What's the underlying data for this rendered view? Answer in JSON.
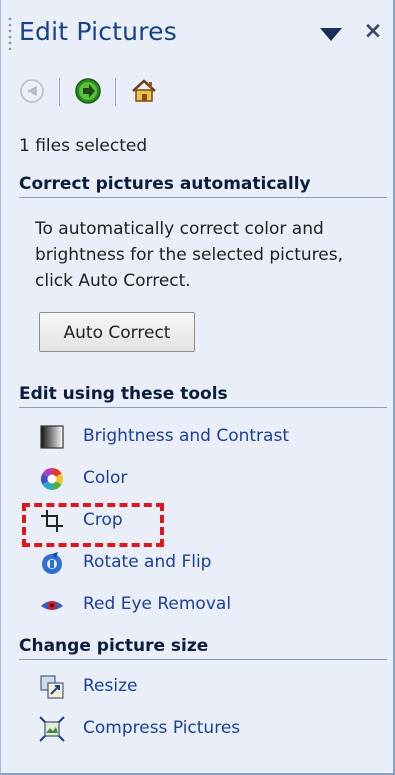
{
  "pane": {
    "title": "Edit Pictures",
    "menu_icon": "dropdown-triangle",
    "close_glyph": "×"
  },
  "nav": {
    "back_icon": "back-arrow-icon",
    "forward_icon": "forward-arrow-icon",
    "home_icon": "home-icon"
  },
  "selection": {
    "count_text": "1 files selected"
  },
  "auto_section": {
    "heading": "Correct pictures automatically",
    "description": "To automatically correct color and brightness for the selected pictures, click Auto Correct.",
    "button_label": "Auto Correct"
  },
  "tools_section": {
    "heading": "Edit using these tools",
    "items": [
      {
        "label": "Brightness and Contrast",
        "icon": "brightness-icon"
      },
      {
        "label": "Color",
        "icon": "color-wheel-icon"
      },
      {
        "label": "Crop",
        "icon": "crop-icon"
      },
      {
        "label": "Rotate and Flip",
        "icon": "rotate-icon"
      },
      {
        "label": "Red Eye Removal",
        "icon": "red-eye-icon"
      }
    ]
  },
  "size_section": {
    "heading": "Change picture size",
    "items": [
      {
        "label": "Resize",
        "icon": "resize-icon"
      },
      {
        "label": "Compress Pictures",
        "icon": "compress-icon"
      }
    ]
  },
  "annotation": {
    "highlight_color": "#e0151e",
    "highlighted_item": "Crop"
  }
}
